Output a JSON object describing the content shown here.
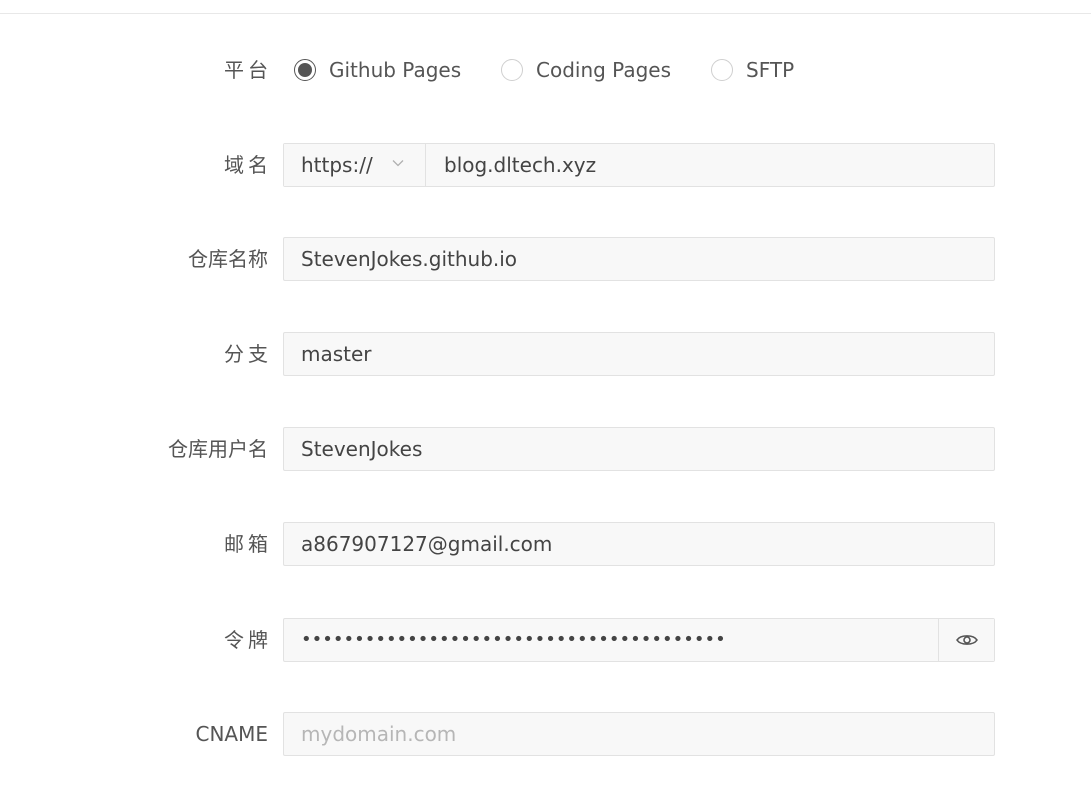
{
  "platform": {
    "label": "平台",
    "options": [
      {
        "label": "Github Pages",
        "checked": true
      },
      {
        "label": "Coding Pages",
        "checked": false
      },
      {
        "label": "SFTP",
        "checked": false
      }
    ]
  },
  "domain": {
    "label": "域名",
    "protocol": "https://",
    "value": "blog.dltech.xyz"
  },
  "repository": {
    "label": "仓库名称",
    "value": "StevenJokes.github.io"
  },
  "branch": {
    "label": "分支",
    "value": "master"
  },
  "username": {
    "label": "仓库用户名",
    "value": "StevenJokes"
  },
  "email": {
    "label": "邮箱",
    "value": "a867907127@gmail.com"
  },
  "token": {
    "label": "令牌",
    "masked_value": "••••••••••••••••••••••••••••••••••••••••",
    "icon": "eye-icon"
  },
  "cname": {
    "label": "CNAME",
    "placeholder": "mydomain.com"
  }
}
